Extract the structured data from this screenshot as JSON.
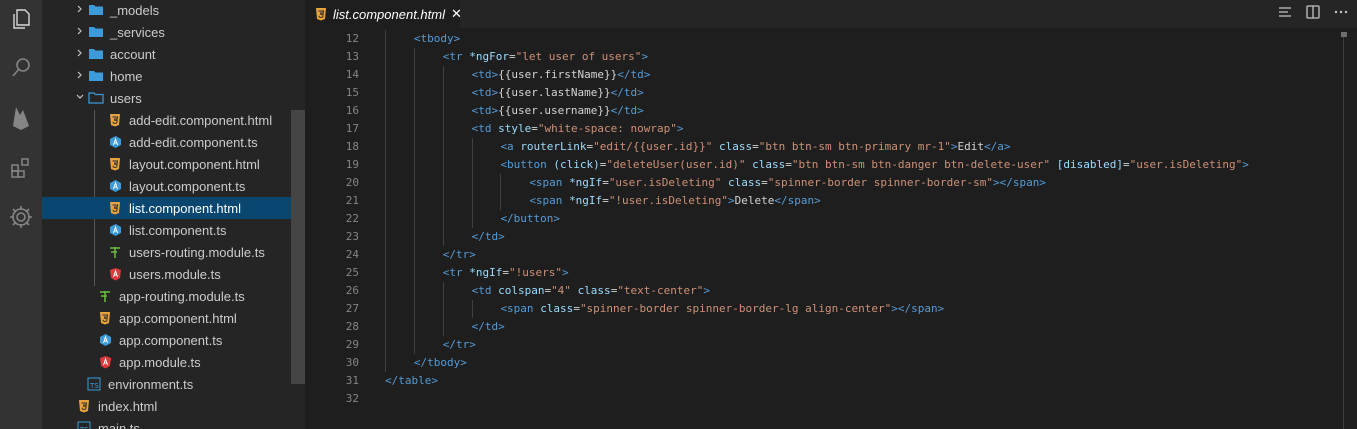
{
  "activity_bar": [
    "files-icon",
    "search-icon",
    "firebase-icon",
    "extensions-icon",
    "settings-icon"
  ],
  "explorer": {
    "items": [
      {
        "label": "_models",
        "kind": "folder",
        "icon": "folder-icon"
      },
      {
        "label": "_services",
        "kind": "folder",
        "icon": "folder-icon"
      },
      {
        "label": "account",
        "kind": "folder",
        "icon": "folder-icon"
      },
      {
        "label": "home",
        "kind": "folder",
        "icon": "folder-icon"
      },
      {
        "label": "users",
        "kind": "folder-open",
        "icon": "folder-open-icon"
      },
      {
        "label": "add-edit.component.html",
        "kind": "html",
        "icon": "html-file-icon"
      },
      {
        "label": "add-edit.component.ts",
        "kind": "ts-angular",
        "icon": "angular-ts-file-icon"
      },
      {
        "label": "layout.component.html",
        "kind": "html",
        "icon": "html-file-icon"
      },
      {
        "label": "layout.component.ts",
        "kind": "ts-angular",
        "icon": "angular-ts-file-icon"
      },
      {
        "label": "list.component.html",
        "kind": "html",
        "icon": "html-file-icon",
        "selected": true
      },
      {
        "label": "list.component.ts",
        "kind": "ts-angular",
        "icon": "angular-ts-file-icon"
      },
      {
        "label": "users-routing.module.ts",
        "kind": "routing",
        "icon": "routing-file-icon"
      },
      {
        "label": "users.module.ts",
        "kind": "module",
        "icon": "angular-module-icon"
      },
      {
        "label": "app-routing.module.ts",
        "kind": "routing",
        "icon": "routing-file-icon"
      },
      {
        "label": "app.component.html",
        "kind": "html",
        "icon": "html-file-icon"
      },
      {
        "label": "app.component.ts",
        "kind": "ts-angular",
        "icon": "angular-ts-file-icon"
      },
      {
        "label": "app.module.ts",
        "kind": "module",
        "icon": "angular-module-icon"
      },
      {
        "label": "environment.ts",
        "kind": "ts",
        "icon": "typescript-file-icon"
      },
      {
        "label": "index.html",
        "kind": "html",
        "icon": "html-file-icon"
      },
      {
        "label": "main.ts",
        "kind": "ts",
        "icon": "typescript-file-icon"
      }
    ]
  },
  "editor": {
    "tab_label": "list.component.html",
    "tab_close": "✕",
    "lines": [
      {
        "n": "12",
        "indent": 1,
        "tokens": [
          [
            "t",
            "<tbody>"
          ]
        ]
      },
      {
        "n": "13",
        "indent": 2,
        "tokens": [
          [
            "t",
            "<tr"
          ],
          [
            "x",
            " "
          ],
          [
            "a",
            "*ngFor"
          ],
          [
            "x",
            "="
          ],
          [
            "s",
            "\"let user of users\""
          ],
          [
            "t",
            ">"
          ]
        ]
      },
      {
        "n": "14",
        "indent": 3,
        "tokens": [
          [
            "t",
            "<td>"
          ],
          [
            "x",
            "{{user.firstName}}"
          ],
          [
            "t",
            "</td>"
          ]
        ]
      },
      {
        "n": "15",
        "indent": 3,
        "tokens": [
          [
            "t",
            "<td>"
          ],
          [
            "x",
            "{{user.lastName}}"
          ],
          [
            "t",
            "</td>"
          ]
        ]
      },
      {
        "n": "16",
        "indent": 3,
        "tokens": [
          [
            "t",
            "<td>"
          ],
          [
            "x",
            "{{user.username}}"
          ],
          [
            "t",
            "</td>"
          ]
        ]
      },
      {
        "n": "17",
        "indent": 3,
        "tokens": [
          [
            "t",
            "<td"
          ],
          [
            "x",
            " "
          ],
          [
            "a",
            "style"
          ],
          [
            "x",
            "="
          ],
          [
            "s",
            "\"white-space: nowrap\""
          ],
          [
            "t",
            ">"
          ]
        ]
      },
      {
        "n": "18",
        "indent": 4,
        "tokens": [
          [
            "t",
            "<a"
          ],
          [
            "x",
            " "
          ],
          [
            "a",
            "routerLink"
          ],
          [
            "x",
            "="
          ],
          [
            "s",
            "\"edit/{{user.id}}\""
          ],
          [
            "x",
            " "
          ],
          [
            "a",
            "class"
          ],
          [
            "x",
            "="
          ],
          [
            "s",
            "\"btn btn-sm btn-primary mr-1\""
          ],
          [
            "t",
            ">"
          ],
          [
            "x",
            "Edit"
          ],
          [
            "t",
            "</a>"
          ]
        ]
      },
      {
        "n": "19",
        "indent": 4,
        "tokens": [
          [
            "t",
            "<button"
          ],
          [
            "x",
            " "
          ],
          [
            "a",
            "(click)"
          ],
          [
            "x",
            "="
          ],
          [
            "s",
            "\"deleteUser(user.id)\""
          ],
          [
            "x",
            " "
          ],
          [
            "a",
            "class"
          ],
          [
            "x",
            "="
          ],
          [
            "s",
            "\"btn btn-sm btn-danger btn-delete-user\""
          ],
          [
            "x",
            " "
          ],
          [
            "a",
            "[disabled]"
          ],
          [
            "x",
            "="
          ],
          [
            "s",
            "\"user.isDeleting\""
          ],
          [
            "t",
            ">"
          ]
        ]
      },
      {
        "n": "20",
        "indent": 5,
        "tokens": [
          [
            "t",
            "<span"
          ],
          [
            "x",
            " "
          ],
          [
            "a",
            "*ngIf"
          ],
          [
            "x",
            "="
          ],
          [
            "s",
            "\"user.isDeleting\""
          ],
          [
            "x",
            " "
          ],
          [
            "a",
            "class"
          ],
          [
            "x",
            "="
          ],
          [
            "s",
            "\"spinner-border spinner-border-sm\""
          ],
          [
            "t",
            "></span>"
          ]
        ]
      },
      {
        "n": "21",
        "indent": 5,
        "tokens": [
          [
            "t",
            "<span"
          ],
          [
            "x",
            " "
          ],
          [
            "a",
            "*ngIf"
          ],
          [
            "x",
            "="
          ],
          [
            "s",
            "\"!user.isDeleting\""
          ],
          [
            "t",
            ">"
          ],
          [
            "x",
            "Delete"
          ],
          [
            "t",
            "</span>"
          ]
        ]
      },
      {
        "n": "22",
        "indent": 4,
        "tokens": [
          [
            "t",
            "</button>"
          ]
        ]
      },
      {
        "n": "23",
        "indent": 3,
        "tokens": [
          [
            "t",
            "</td>"
          ]
        ]
      },
      {
        "n": "24",
        "indent": 2,
        "tokens": [
          [
            "t",
            "</tr>"
          ]
        ]
      },
      {
        "n": "25",
        "indent": 2,
        "tokens": [
          [
            "t",
            "<tr"
          ],
          [
            "x",
            " "
          ],
          [
            "a",
            "*ngIf"
          ],
          [
            "x",
            "="
          ],
          [
            "s",
            "\"!users\""
          ],
          [
            "t",
            ">"
          ]
        ]
      },
      {
        "n": "26",
        "indent": 3,
        "tokens": [
          [
            "t",
            "<td"
          ],
          [
            "x",
            " "
          ],
          [
            "a",
            "colspan"
          ],
          [
            "x",
            "="
          ],
          [
            "s",
            "\"4\""
          ],
          [
            "x",
            " "
          ],
          [
            "a",
            "class"
          ],
          [
            "x",
            "="
          ],
          [
            "s",
            "\"text-center\""
          ],
          [
            "t",
            ">"
          ]
        ]
      },
      {
        "n": "27",
        "indent": 4,
        "tokens": [
          [
            "t",
            "<span"
          ],
          [
            "x",
            " "
          ],
          [
            "a",
            "class"
          ],
          [
            "x",
            "="
          ],
          [
            "s",
            "\"spinner-border spinner-border-lg align-center\""
          ],
          [
            "t",
            "></span>"
          ]
        ]
      },
      {
        "n": "28",
        "indent": 3,
        "tokens": [
          [
            "t",
            "</td>"
          ]
        ]
      },
      {
        "n": "29",
        "indent": 2,
        "tokens": [
          [
            "t",
            "</tr>"
          ]
        ]
      },
      {
        "n": "30",
        "indent": 1,
        "tokens": [
          [
            "t",
            "</tbody>"
          ]
        ]
      },
      {
        "n": "31",
        "indent": 0,
        "tokens": [
          [
            "t",
            "</table>"
          ]
        ]
      },
      {
        "n": "32",
        "indent": 0,
        "tokens": []
      }
    ]
  },
  "colors": {
    "accent": "#094771",
    "tag": "#569cd6",
    "attr": "#9cdcfe",
    "string": "#ce9178"
  }
}
